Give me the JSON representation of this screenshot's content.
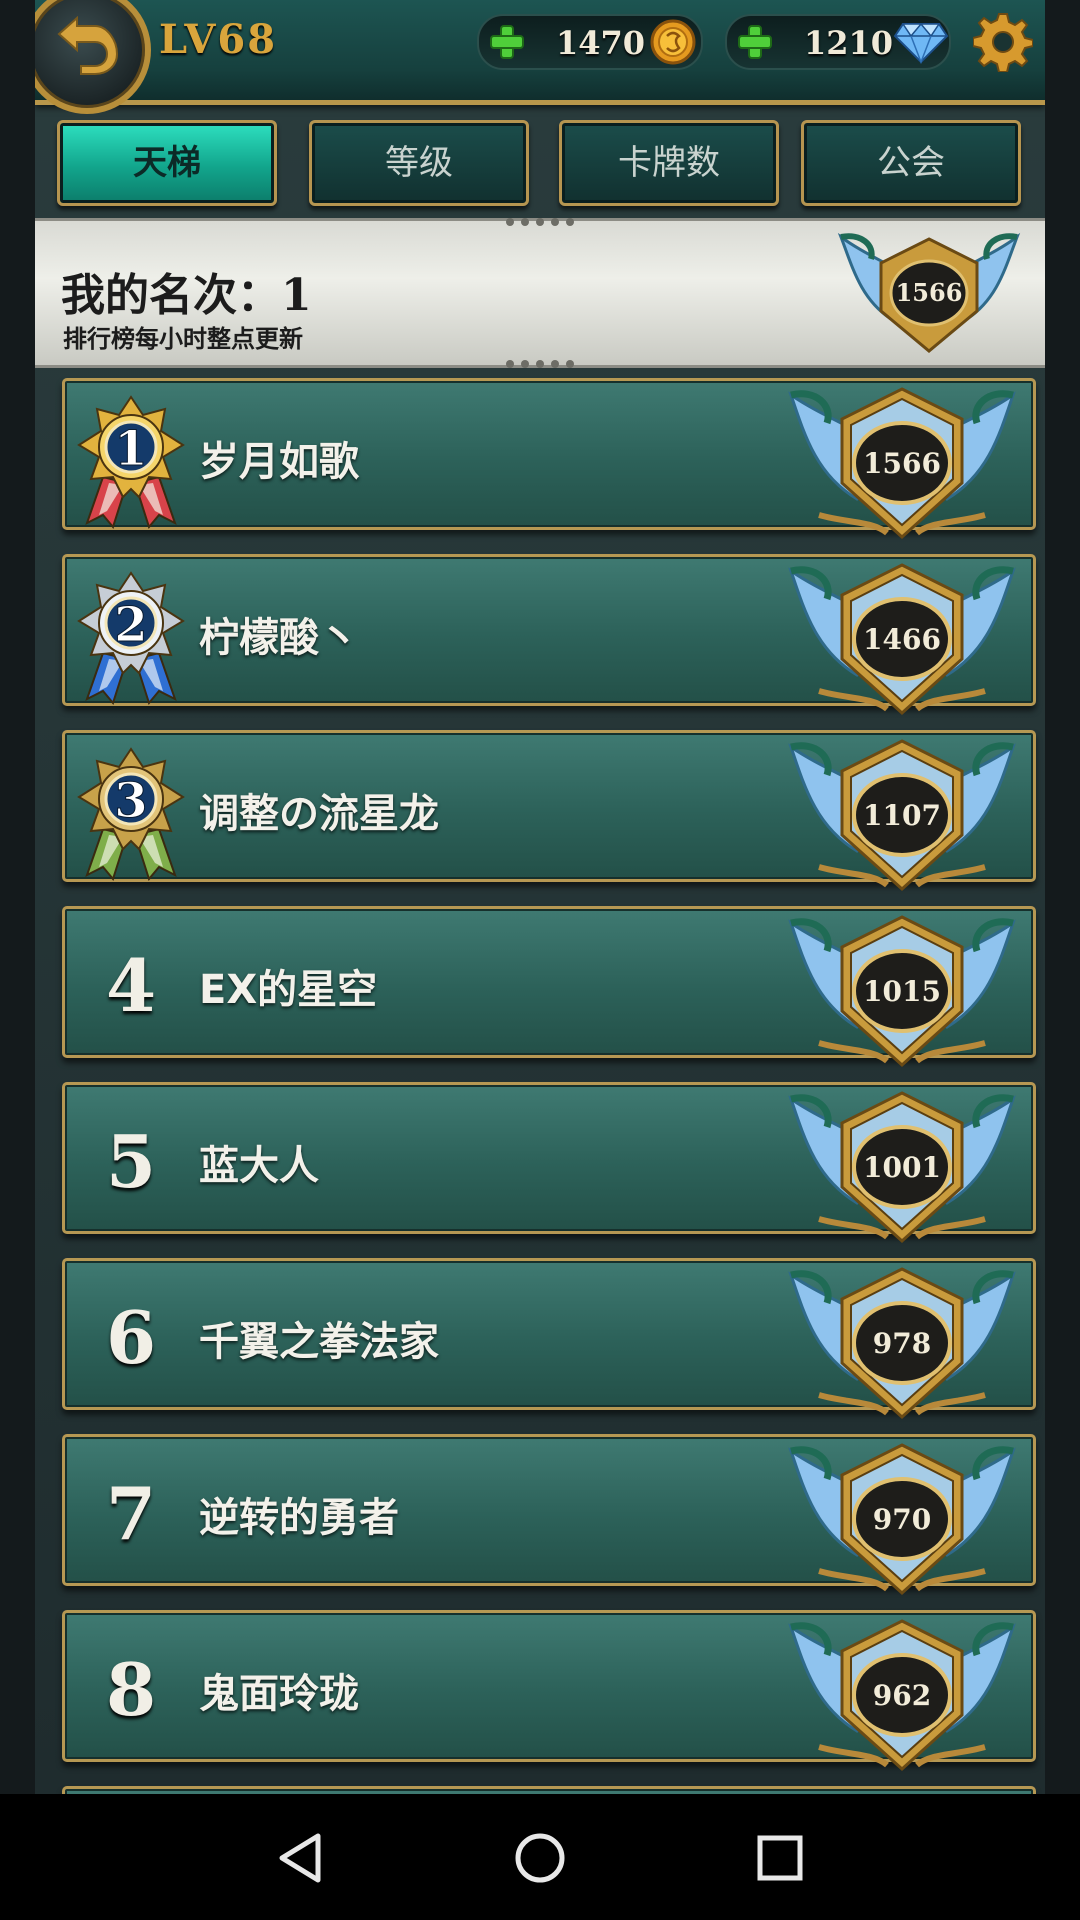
{
  "header": {
    "level": "LV68",
    "gold": "1470",
    "diamonds": "1210"
  },
  "tabs": [
    {
      "label": "天梯",
      "active": true
    },
    {
      "label": "等级",
      "active": false
    },
    {
      "label": "卡牌数",
      "active": false
    },
    {
      "label": "公会",
      "active": false
    }
  ],
  "my_rank": {
    "label": "我的名次：1",
    "note": "排行榜每小时整点更新",
    "score": "1566"
  },
  "leaderboard": [
    {
      "rank": "1",
      "name": "岁月如歌",
      "score": "1566",
      "medal": "gold-medal-icon"
    },
    {
      "rank": "2",
      "name": "柠檬酸丶",
      "score": "1466",
      "medal": "silver-medal-icon"
    },
    {
      "rank": "3",
      "name": "调整の流星龙",
      "score": "1107",
      "medal": "bronze-medal-icon"
    },
    {
      "rank": "4",
      "name": "EX的星空",
      "score": "1015"
    },
    {
      "rank": "5",
      "name": "蓝大人",
      "score": "1001"
    },
    {
      "rank": "6",
      "name": "千翼之拳法家",
      "score": "978"
    },
    {
      "rank": "7",
      "name": "逆转的勇者",
      "score": "970"
    },
    {
      "rank": "8",
      "name": "鬼面玲珑",
      "score": "962"
    }
  ],
  "colors": {
    "accent_teal": "#2ee0c0",
    "gold_trim": "#b69853",
    "row_green": "#2c6159"
  }
}
